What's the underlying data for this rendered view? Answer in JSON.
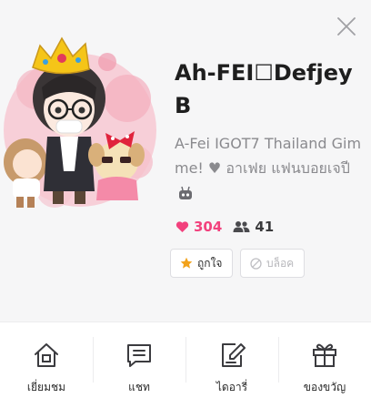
{
  "profile": {
    "name": "Ah-FEI☐Defjey B",
    "status": "A-Fei IGOT7 Thailand Gimme! ♥ อาเฟย แฟนบอยเจปี",
    "likes": "304",
    "friends": "41"
  },
  "actions": {
    "like_label": "ถูกใจ",
    "block_label": "บล็อค"
  },
  "bottom_nav": {
    "visit": "เยี่ยมชม",
    "chat": "แชท",
    "diary": "ไดอารี่",
    "gift": "ของขวัญ"
  },
  "icons": {
    "close": "close-icon",
    "heart": "heart-icon",
    "friends": "friends-icon",
    "star": "star-icon",
    "block": "block-icon",
    "robot": "robot-emoji-icon",
    "home": "home-icon",
    "chat": "chat-icon",
    "diary": "diary-edit-icon",
    "gift": "gift-icon"
  },
  "colors": {
    "accent_pink": "#f2417d",
    "star_orange": "#f2a21b",
    "text_gray": "#8a8a8e"
  }
}
